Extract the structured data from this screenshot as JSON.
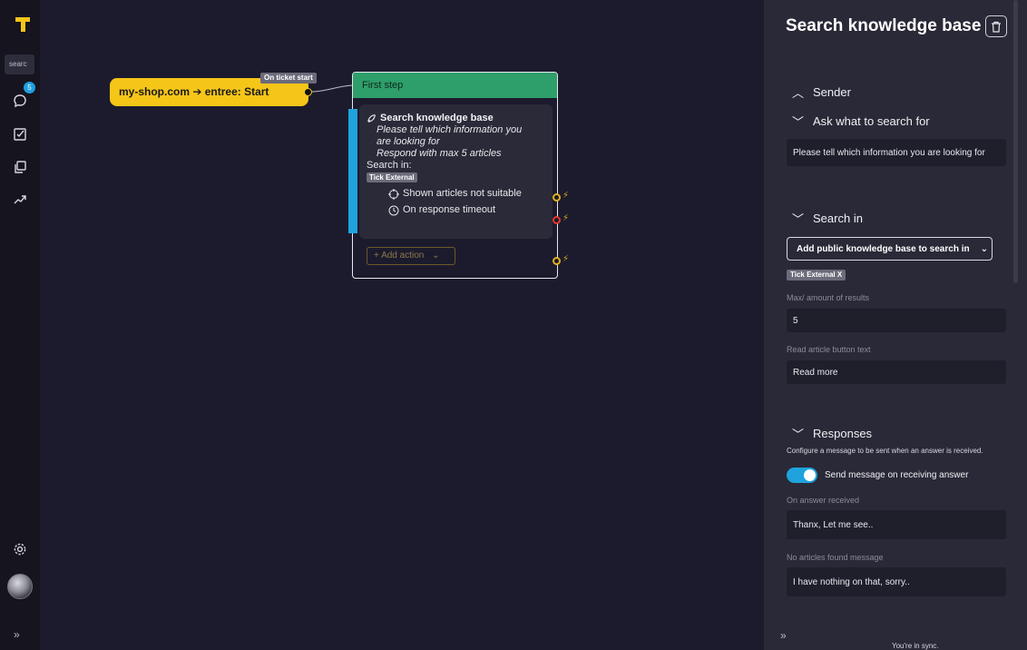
{
  "sidebar": {
    "search_text": "searc",
    "chat_badge": "5",
    "icons": [
      "logo-icon",
      "chat-icon",
      "tasks-icon",
      "copy-icon",
      "trending-icon",
      "settings-icon",
      "avatar",
      "expand-icon"
    ]
  },
  "canvas": {
    "start_node_label": "my-shop.com ➔ entree: Start",
    "start_tag": "On ticket start",
    "step": {
      "header": "First step",
      "action_title": "Search knowledge base",
      "question_line1": "Please tell which information you",
      "question_line2": "are looking for",
      "respond_line": "Respond with max 5 articles",
      "search_in_label": "Search in:",
      "search_in_badge": "Tick External",
      "branch1": "Shown articles not suitable",
      "branch2": "On response timeout",
      "add_action": "Add action"
    }
  },
  "panel": {
    "title": "Search knowledge base",
    "sections": {
      "sender": "Sender",
      "ask": "Ask what to search for",
      "search_in": "Search in",
      "responses": "Responses"
    },
    "ask_value": "Please tell which information you are looking for",
    "kb_select": "Add public knowledge base to search in",
    "kb_badge": "Tick External X",
    "max_label": "Max/ amount of results",
    "max_value": "5",
    "read_label": "Read article button text",
    "read_value": "Read more",
    "responses_desc": "Configure a message to be sent when an answer is received.",
    "toggle_label": "Send message on receiving answer",
    "toggle_on": true,
    "on_answer_label": "On answer received",
    "on_answer_value": "Thanx, Let me see..",
    "no_articles_label": "No articles found message",
    "no_articles_value": "I have nothing on that, sorry..",
    "sync_text": "You're in sync."
  },
  "colors": {
    "accent_yellow": "#f5c518",
    "step_green": "#2e9e6a",
    "accent_blue": "#1ea3dc",
    "warning_red": "#e03c2c"
  }
}
